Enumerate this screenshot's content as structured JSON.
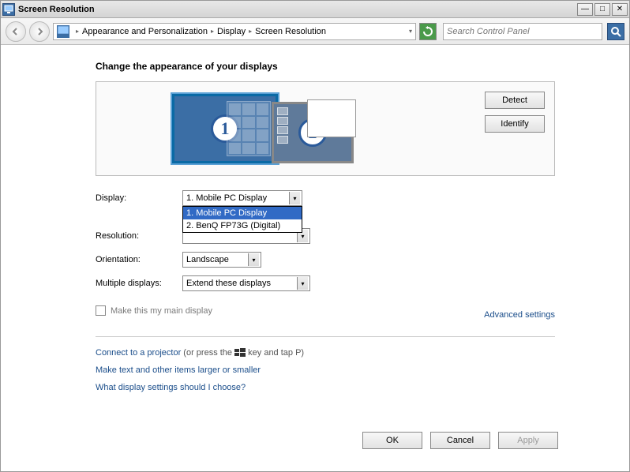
{
  "titlebar": {
    "title": "Screen Resolution"
  },
  "breadcrumb": {
    "parts": [
      "Appearance and Personalization",
      "Display",
      "Screen Resolution"
    ]
  },
  "search": {
    "placeholder": "Search Control Panel"
  },
  "heading": "Change the appearance of your displays",
  "preview": {
    "monitor1": "1",
    "monitor2": "2",
    "detect": "Detect",
    "identify": "Identify"
  },
  "form": {
    "display_label": "Display:",
    "display_value": "1. Mobile PC Display",
    "display_options": [
      "1. Mobile PC Display",
      "2. BenQ FP73G (Digital)"
    ],
    "resolution_label": "Resolution:",
    "resolution_value": "",
    "orientation_label": "Orientation:",
    "orientation_value": "Landscape",
    "multiple_label": "Multiple displays:",
    "multiple_value": "Extend these displays"
  },
  "checkbox_label": "Make this my main display",
  "advanced": "Advanced settings",
  "links": {
    "projector_prefix": "Connect to a projector",
    "projector_hint": " (or press the ",
    "projector_suffix": " key and tap P)",
    "textsize": "Make text and other items larger or smaller",
    "help": "What display settings should I choose?"
  },
  "buttons": {
    "ok": "OK",
    "cancel": "Cancel",
    "apply": "Apply"
  }
}
